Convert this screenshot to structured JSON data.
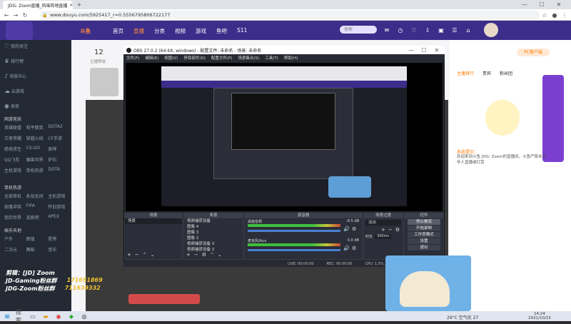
{
  "browser": {
    "tab_title": "JDG- Zoom直播_风味阵地直播",
    "url": "www.douyu.com/5925417_r=0.5556795806722177",
    "controls": {
      "min": "—",
      "max": "☐",
      "close": "✕"
    }
  },
  "header": {
    "logo": "斗鱼",
    "nav": [
      "首页",
      "直播",
      "分类",
      "视频",
      "游戏",
      "鱼吧",
      "S11"
    ],
    "search_placeholder": "搜索"
  },
  "room": {
    "level": "12",
    "level_label": "主播等级",
    "pc_badge": "PC客户端"
  },
  "sidebar": {
    "items": [
      "我的关注",
      "排行榜",
      "消息中心",
      "云游戏",
      "发现"
    ],
    "section1": "网游竞技",
    "grid1": [
      "英雄联盟",
      "和平精英",
      "DOTA2",
      "王者荣耀",
      "穿越火线",
      "CF手游",
      "绝地求生",
      "CS:GO",
      "原神",
      "QQ飞车",
      "魔兽世界",
      "炉石",
      "主机游戏",
      "单机热游",
      "DOTA"
    ],
    "section2": "单机热游",
    "grid2": [
      "全部单机",
      "永劫无间",
      "主机游戏",
      "部落冲突",
      "FIFA",
      "怀旧游戏",
      "我的世界",
      "逃跑吧",
      "APEX"
    ],
    "section3": "娱乐天地",
    "grid3": [
      "户外",
      "颜值",
      "星秀",
      "二次元",
      "舞蹈",
      "音乐"
    ]
  },
  "obs": {
    "title": "OBS 27.0.2 (64-bit, windows) - 配置文件: 未命名 - 场景: 未命名",
    "menu": [
      "文件(F)",
      "编辑(E)",
      "视图(V)",
      "停靠部件(D)",
      "配置文件(P)",
      "场景集合(S)",
      "工具(T)",
      "帮助(H)"
    ],
    "docks": {
      "scenes": "场景",
      "sources": "来源",
      "mixer": "混音器",
      "transitions": "场景过渡",
      "controls": "控件"
    },
    "scene_items": [
      "场景"
    ],
    "source_items": [
      "视频捕获设备",
      "图像 4",
      "图像 3",
      "图像 2",
      "视频捕获设备 3",
      "视频捕获设备 2"
    ],
    "mixer_channels": [
      {
        "name": "桌面音频",
        "db": "-8.5 dB"
      },
      {
        "name": "麦克风/Aux",
        "db": "0.0 dB"
      }
    ],
    "transition": {
      "type": "淡出",
      "duration_label": "时长",
      "duration": "300ms"
    },
    "control_buttons": [
      "停止推流",
      "开始录制",
      "工作室模式",
      "设置",
      "退出"
    ],
    "status": {
      "live": "LIVE: 00:00:00",
      "rec": "REC: 00:00:00",
      "cpu": "CPU: 1.5%, 60.00 fps"
    }
  },
  "overlay": {
    "line1": "剪辑：[JD] Zoom",
    "line2_left": "JD-Gaming粉丝群",
    "line2_right": "171651869",
    "line3_left": "JDG-Zoom粉丝群",
    "line3_right": "711639332"
  },
  "right_panel": {
    "tabs": [
      "主播排行",
      "贵宾",
      "粉丝团"
    ],
    "bottom_tip": "系统提示：",
    "chat_text": "欢迎来到斗鱼 JDG- Zoom的直播间，斗鱼严禁未成年人直播或打赏"
  },
  "taskbar": {
    "weather": "29°C 空气优 27",
    "time": "14:24",
    "date": "2021/10/15",
    "search_icon": "搜索"
  },
  "colors": {
    "douyu_purple": "#3c2d8a",
    "obs_bg": "#272a33",
    "accent_orange": "#ff7a00"
  }
}
